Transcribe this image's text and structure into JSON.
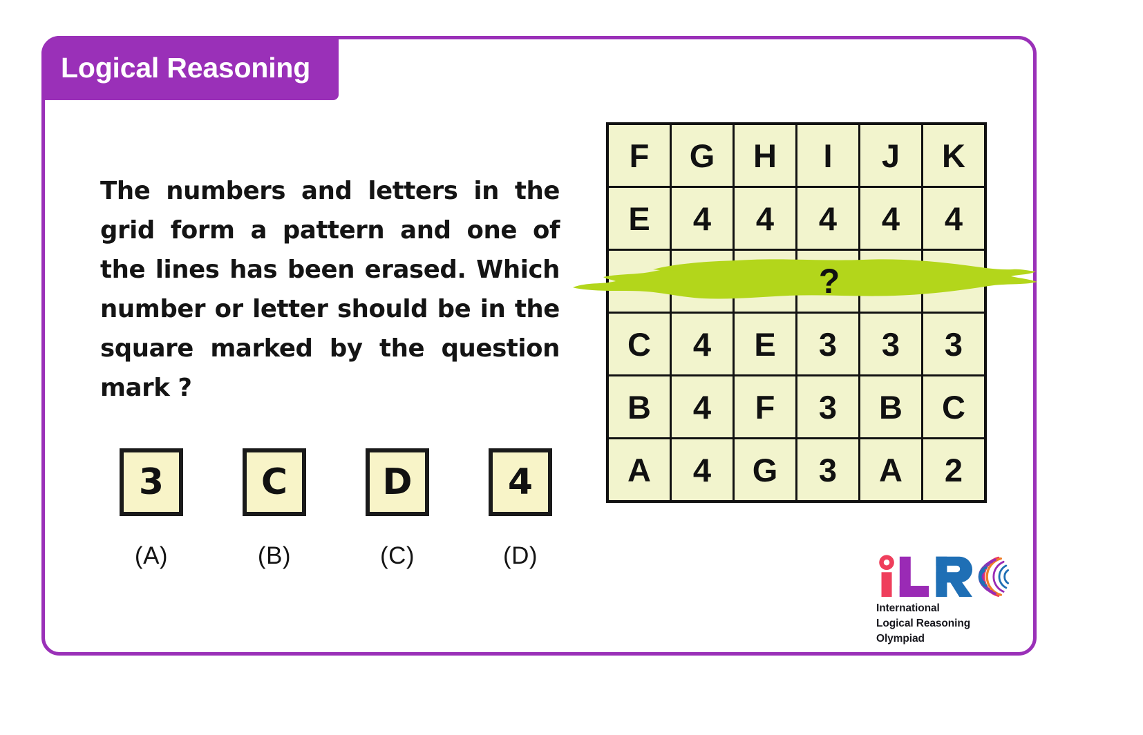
{
  "header": {
    "title": "Logical Reasoning",
    "accent_color": "#9a30b8"
  },
  "question": {
    "text": "The numbers and letters in the grid form a pattern and one of the lines has been erased. Which number or letter should be in the square marked by the question mark ?"
  },
  "grid": {
    "rows": 6,
    "cols": 6,
    "cell_bg": "#f2f4cd",
    "border_color": "#111111",
    "erased_row_index": 2,
    "erase_stroke_color": "#b3d61b",
    "question_mark": "?",
    "question_mark_col": 3,
    "cells": [
      [
        "F",
        "G",
        "H",
        "I",
        "J",
        "K"
      ],
      [
        "E",
        "4",
        "4",
        "4",
        "4",
        "4"
      ],
      [
        "",
        "",
        "",
        "?",
        "",
        ""
      ],
      [
        "C",
        "4",
        "E",
        "3",
        "3",
        "3"
      ],
      [
        "B",
        "4",
        "F",
        "3",
        "B",
        "C"
      ],
      [
        "A",
        "4",
        "G",
        "3",
        "A",
        "2"
      ]
    ]
  },
  "options": [
    {
      "value": "3",
      "label": "(A)"
    },
    {
      "value": "C",
      "label": "(B)"
    },
    {
      "value": "D",
      "label": "(C)"
    },
    {
      "value": "4",
      "label": "(D)"
    }
  ],
  "option_style": {
    "box_bg": "#f8f4c8",
    "box_border": "#1a1a1a"
  },
  "logo": {
    "letters": [
      {
        "char": "i",
        "color": "#ef3e5c"
      },
      {
        "char": "L",
        "color": "#9a2ab5"
      },
      {
        "char": "R",
        "color": "#1f6fb5"
      }
    ],
    "swirl_colors": [
      "#ef3e5c",
      "#f07d28",
      "#9a2ab5",
      "#1f6fb5"
    ],
    "lines": [
      "International",
      "Logical Reasoning",
      "Olympiad"
    ]
  }
}
